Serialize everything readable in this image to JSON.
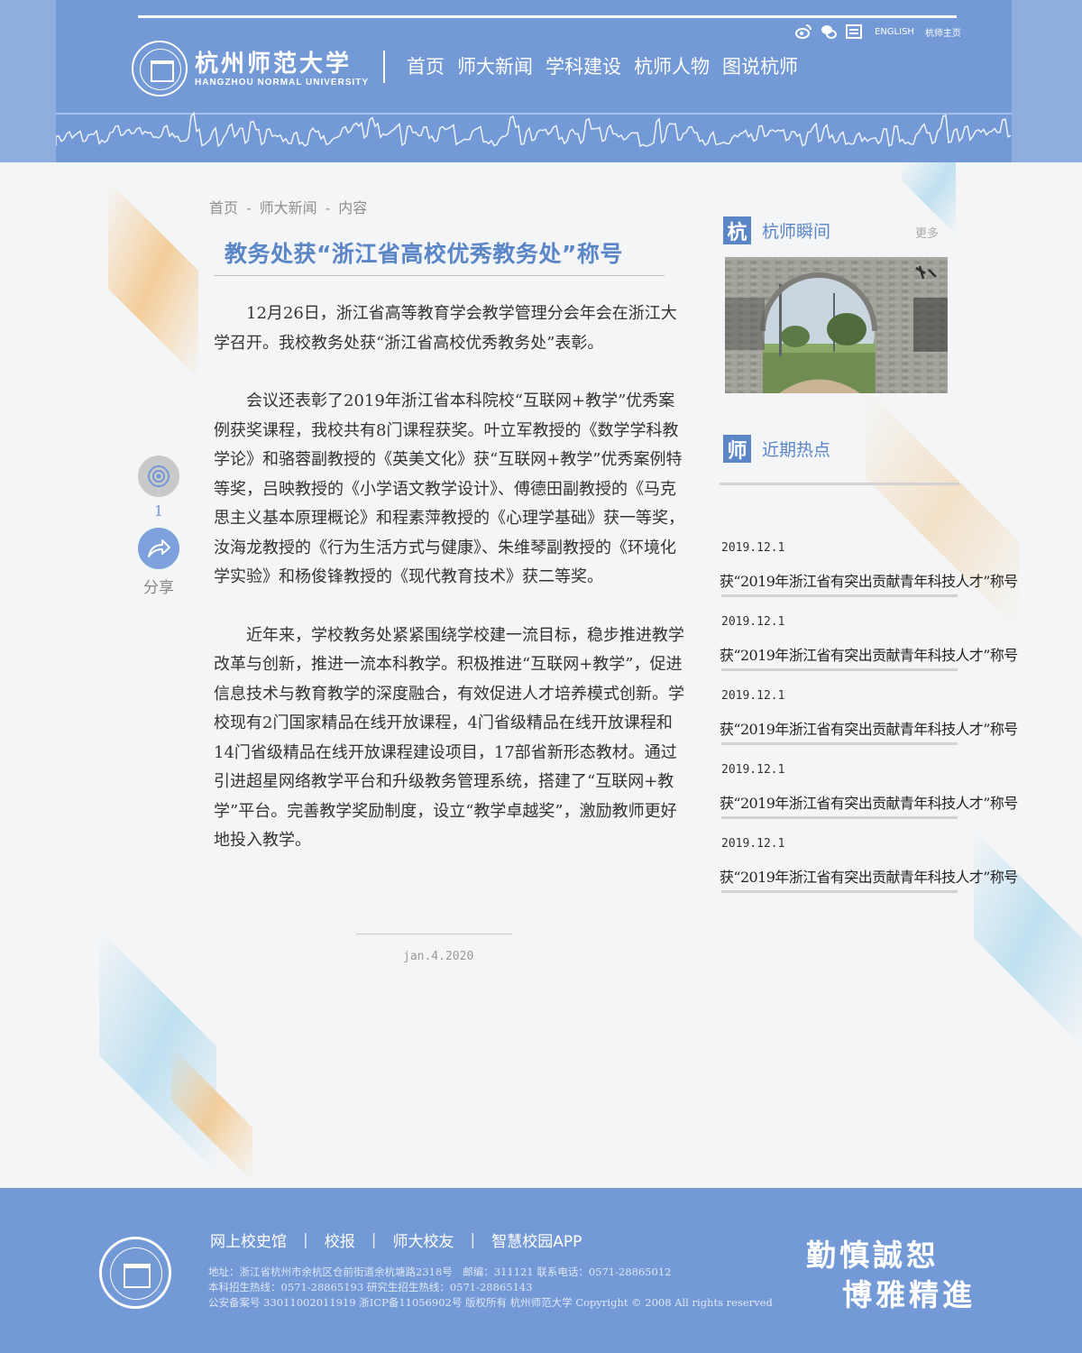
{
  "header": {
    "logo_cn": "杭州师范大学",
    "logo_en": "HANGZHOU NORMAL UNIVERSITY",
    "nav": [
      "首页",
      "师大新闻",
      "学科建设",
      "杭师人物",
      "图说杭师"
    ],
    "icons": [
      "weibo-icon",
      "wechat-icon",
      "news-icon"
    ],
    "english_link": "ENGLISH",
    "home_link": "杭师主页",
    "colors": {
      "bar": "#7399d6",
      "accent": "#5a86c8"
    }
  },
  "breadcrumb": [
    "首页",
    "-",
    "师大新闻",
    "-",
    "内容"
  ],
  "article": {
    "title": "教务处获“浙江省高校优秀教务处”称号",
    "paragraphs": [
      "12月26日，浙江省高等教育学会教学管理分会年会在浙江大学召开。我校教务处获“浙江省高校优秀教务处”表彰。",
      "会议还表彰了2019年浙江省本科院校“互联网+教学”优秀案例获奖课程，我校共有8门课程获奖。叶立军教授的《数学学科教学论》和骆蓉副教授的《英美文化》获“互联网+教学”优秀案例特等奖，吕映教授的《小学语文教学设计》、傅德田副教授的《马克思主义基本原理概论》和程素萍教授的《心理学基础》获一等奖，汝海龙教授的《行为生活方式与健康》、朱维琴副教授的《环境化学实验》和杨俊锋教授的《现代教育技术》获二等奖。",
      "近年来，学校教务处紧紧围绕学校建一流目标，稳步推进教学改革与创新，推进一流本科教学。积极推进“互联网+教学”，促进信息技术与教育教学的深度融合，有效促进人才培养模式创新。学校现有2门国家精品在线开放课程，4门省级精品在线开放课程和14门省级精品在线开放课程建设项目，17部省新形态教材。通过引进超星网络教学平台和升级教务管理系统，搭建了“互联网+教学”平台。完善教学奖励制度，设立“教学卓越奖”，激励教师更好地投入教学。"
    ],
    "date": "jan.4.2020"
  },
  "side_tools": {
    "view_count": "1",
    "share_label": "分享"
  },
  "sidebar": {
    "moments": {
      "badge": "杭",
      "title": "杭师瞬间",
      "more": "更多"
    },
    "hot": {
      "badge": "师",
      "title": "近期热点",
      "items": [
        {
          "date": "2019.12.1",
          "title": "获“2019年浙江省有突出贡献青年科技人才”称号"
        },
        {
          "date": "2019.12.1",
          "title": "获“2019年浙江省有突出贡献青年科技人才”称号"
        },
        {
          "date": "2019.12.1",
          "title": "获“2019年浙江省有突出贡献青年科技人才”称号"
        },
        {
          "date": "2019.12.1",
          "title": "获“2019年浙江省有突出贡献青年科技人才”称号"
        },
        {
          "date": "2019.12.1",
          "title": "获“2019年浙江省有突出贡献青年科技人才”称号"
        }
      ]
    }
  },
  "footer": {
    "links": [
      "网上校史馆",
      "校报",
      "师大校友",
      "智慧校园APP"
    ],
    "link_sep": "|",
    "info": [
      "地址：浙江省杭州市余杭区仓前街道余杭塘路2318号　邮编：311121 联系电话：0571-28865012",
      "本科招生热线：0571-28865193 研究生招生热线：0571-28865143",
      "公安备案号 33011002011919 浙ICP备11056902号 版权所有 杭州师范大学 Copyright © 2008 All rights reserved"
    ],
    "motto": [
      "勤慎誠恕",
      "博雅精進"
    ]
  }
}
